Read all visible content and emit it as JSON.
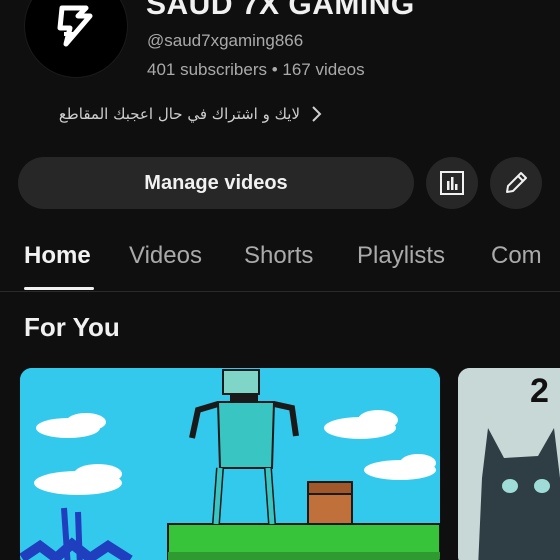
{
  "channel": {
    "name": "SAUD 7X GAMING",
    "handle": "@saud7xgaming866",
    "stats": "401 subscribers • 167 videos",
    "description": "لايك و اشتراك في حال  اعجبك المقاطع"
  },
  "actions": {
    "manage_label": "Manage videos"
  },
  "tabs": [
    {
      "label": "Home",
      "active": true
    },
    {
      "label": "Videos"
    },
    {
      "label": "Shorts"
    },
    {
      "label": "Playlists"
    },
    {
      "label": "Com"
    }
  ],
  "section": {
    "title": "For You"
  },
  "videos": [
    {
      "thumbnail": "cartoon-character-on-green-platform"
    },
    {
      "thumbnail": "dark-cat-figure",
      "overlay_text": "2"
    }
  ],
  "colors": {
    "background": "#0f0f0f",
    "button": "#272727",
    "secondary_text": "#aaaaaa",
    "thumb_sky": "#32c9ec"
  }
}
